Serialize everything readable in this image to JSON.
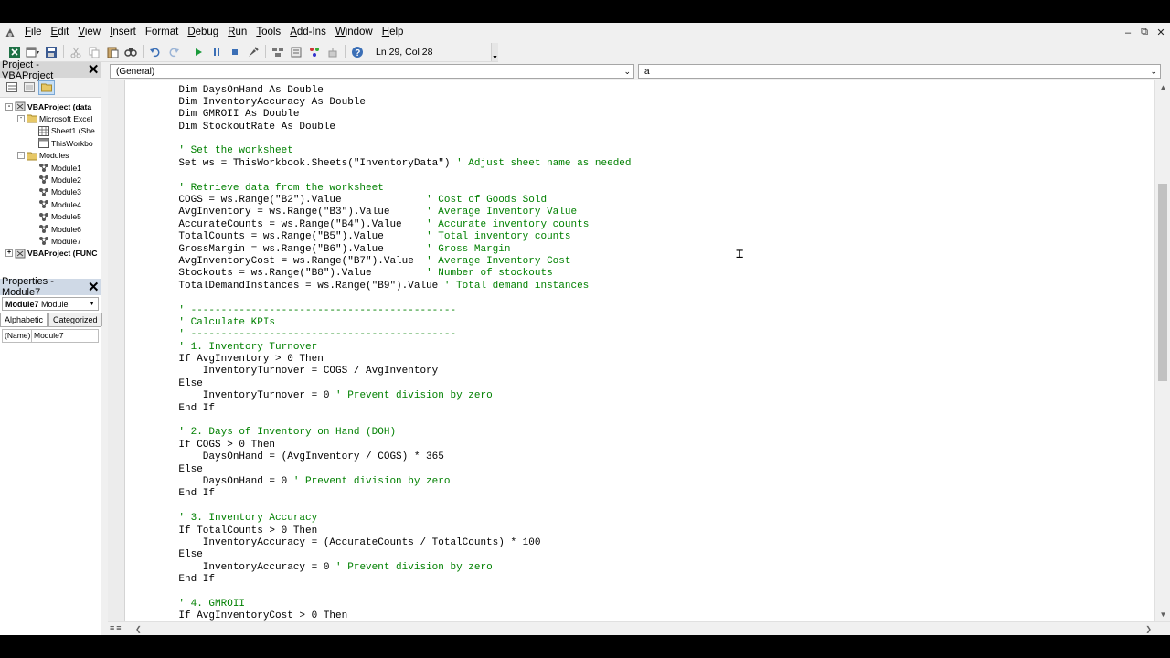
{
  "menubar": {
    "items": [
      {
        "label": "File",
        "ul": "F",
        "rest": "ile"
      },
      {
        "label": "Edit",
        "ul": "E",
        "rest": "dit"
      },
      {
        "label": "View",
        "ul": "V",
        "rest": "iew"
      },
      {
        "label": "Insert",
        "ul": "I",
        "rest": "nsert"
      },
      {
        "label": "Format",
        "ul": "",
        "rest": "Format"
      },
      {
        "label": "Debug",
        "ul": "D",
        "rest": "ebug"
      },
      {
        "label": "Run",
        "ul": "R",
        "rest": "un"
      },
      {
        "label": "Tools",
        "ul": "T",
        "rest": "ools"
      },
      {
        "label": "Add-Ins",
        "ul": "A",
        "rest": "dd-Ins"
      },
      {
        "label": "Window",
        "ul": "W",
        "rest": "indow"
      },
      {
        "label": "Help",
        "ul": "H",
        "rest": "elp"
      }
    ]
  },
  "toolbar": {
    "position_text": "Ln 29, Col 28"
  },
  "project": {
    "title": "Project - VBAProject",
    "tree": [
      {
        "label": "VBAProject (data",
        "bold": true,
        "icon": "vba-project-icon",
        "indent": 0,
        "exp": "-"
      },
      {
        "label": "Microsoft Excel",
        "bold": false,
        "icon": "folder-icon",
        "indent": 1,
        "exp": "-"
      },
      {
        "label": "Sheet1 (She",
        "bold": false,
        "icon": "sheet-icon",
        "indent": 2,
        "exp": ""
      },
      {
        "label": "ThisWorkbo",
        "bold": false,
        "icon": "workbook-icon",
        "indent": 2,
        "exp": ""
      },
      {
        "label": "Modules",
        "bold": false,
        "icon": "folder-icon",
        "indent": 1,
        "exp": "-"
      },
      {
        "label": "Module1",
        "bold": false,
        "icon": "module-icon",
        "indent": 2,
        "exp": ""
      },
      {
        "label": "Module2",
        "bold": false,
        "icon": "module-icon",
        "indent": 2,
        "exp": ""
      },
      {
        "label": "Module3",
        "bold": false,
        "icon": "module-icon",
        "indent": 2,
        "exp": ""
      },
      {
        "label": "Module4",
        "bold": false,
        "icon": "module-icon",
        "indent": 2,
        "exp": ""
      },
      {
        "label": "Module5",
        "bold": false,
        "icon": "module-icon",
        "indent": 2,
        "exp": ""
      },
      {
        "label": "Module6",
        "bold": false,
        "icon": "module-icon",
        "indent": 2,
        "exp": ""
      },
      {
        "label": "Module7",
        "bold": false,
        "icon": "module-icon",
        "indent": 2,
        "exp": ""
      },
      {
        "label": "VBAProject (FUNC",
        "bold": true,
        "icon": "vba-project-icon",
        "indent": 0,
        "exp": "+"
      }
    ]
  },
  "properties": {
    "title": "Properties - Module7",
    "selected_object_name": "Module7",
    "selected_object_type": "Module",
    "tabs": [
      "Alphabetic",
      "Categorized"
    ],
    "rows": [
      {
        "name": "(Name)",
        "value": "Module7"
      }
    ]
  },
  "code_window": {
    "object_combo": "(General)",
    "procedure_combo": "a",
    "lines": [
      [
        {
          "t": "    Dim DaysOnHand As Double",
          "c": ""
        }
      ],
      [
        {
          "t": "    Dim InventoryAccuracy As Double",
          "c": ""
        }
      ],
      [
        {
          "t": "    Dim GMROII As Double",
          "c": ""
        }
      ],
      [
        {
          "t": "    Dim StockoutRate As Double",
          "c": ""
        }
      ],
      [
        {
          "t": "",
          "c": ""
        }
      ],
      [
        {
          "t": "    ' Set the worksheet",
          "c": "g"
        }
      ],
      [
        {
          "t": "    Set ws = ThisWorkbook.Sheets(\"InventoryData\") ",
          "c": ""
        },
        {
          "t": "' Adjust sheet name as needed",
          "c": "g"
        }
      ],
      [
        {
          "t": "",
          "c": ""
        }
      ],
      [
        {
          "t": "    ' Retrieve data from the worksheet",
          "c": "g"
        }
      ],
      [
        {
          "t": "    COGS = ws.Range(\"B2\").Value              ",
          "c": ""
        },
        {
          "t": "' Cost of Goods Sold",
          "c": "g"
        }
      ],
      [
        {
          "t": "    AvgInventory = ws.Range(\"B3\").Value      ",
          "c": ""
        },
        {
          "t": "' Average Inventory Value",
          "c": "g"
        }
      ],
      [
        {
          "t": "    AccurateCounts = ws.Range(\"B4\").Value    ",
          "c": ""
        },
        {
          "t": "' Accurate inventory counts",
          "c": "g"
        }
      ],
      [
        {
          "t": "    TotalCounts = ws.Range(\"B5\").Value       ",
          "c": ""
        },
        {
          "t": "' Total inventory counts",
          "c": "g"
        }
      ],
      [
        {
          "t": "    GrossMargin = ws.Range(\"B6\").Value       ",
          "c": ""
        },
        {
          "t": "' Gross Margin",
          "c": "g"
        }
      ],
      [
        {
          "t": "    AvgInventoryCost = ws.Range(\"B7\").Value  ",
          "c": ""
        },
        {
          "t": "' Average Inventory Cost",
          "c": "g"
        }
      ],
      [
        {
          "t": "    Stockouts = ws.Range(\"B8\").Value         ",
          "c": ""
        },
        {
          "t": "' Number of stockouts",
          "c": "g"
        }
      ],
      [
        {
          "t": "    TotalDemandInstances = ws.Range(\"B9\").Value ",
          "c": ""
        },
        {
          "t": "' Total demand instances",
          "c": "g"
        }
      ],
      [
        {
          "t": "",
          "c": ""
        }
      ],
      [
        {
          "t": "    ' --------------------------------------------",
          "c": "g"
        }
      ],
      [
        {
          "t": "    ' Calculate KPIs",
          "c": "g"
        }
      ],
      [
        {
          "t": "    ' --------------------------------------------",
          "c": "g"
        }
      ],
      [
        {
          "t": "    ' 1. Inventory Turnover",
          "c": "g"
        }
      ],
      [
        {
          "t": "    If AvgInventory > 0 Then",
          "c": ""
        }
      ],
      [
        {
          "t": "        InventoryTurnover = COGS / AvgInventory",
          "c": ""
        }
      ],
      [
        {
          "t": "    Else",
          "c": ""
        }
      ],
      [
        {
          "t": "        InventoryTurnover = 0 ",
          "c": ""
        },
        {
          "t": "' Prevent division by zero",
          "c": "g"
        }
      ],
      [
        {
          "t": "    End If",
          "c": ""
        }
      ],
      [
        {
          "t": "",
          "c": ""
        }
      ],
      [
        {
          "t": "    ' 2. Days of Inventory on Hand (DOH)",
          "c": "g"
        }
      ],
      [
        {
          "t": "    If COGS > 0 Then",
          "c": ""
        }
      ],
      [
        {
          "t": "        DaysOnHand = (AvgInventory / COGS) * 365",
          "c": ""
        }
      ],
      [
        {
          "t": "    Else",
          "c": ""
        }
      ],
      [
        {
          "t": "        DaysOnHand = 0 ",
          "c": ""
        },
        {
          "t": "' Prevent division by zero",
          "c": "g"
        }
      ],
      [
        {
          "t": "    End If",
          "c": ""
        }
      ],
      [
        {
          "t": "",
          "c": ""
        }
      ],
      [
        {
          "t": "    ' 3. Inventory Accuracy",
          "c": "g"
        }
      ],
      [
        {
          "t": "    If TotalCounts > 0 Then",
          "c": ""
        }
      ],
      [
        {
          "t": "        InventoryAccuracy = (AccurateCounts / TotalCounts) * 100",
          "c": ""
        }
      ],
      [
        {
          "t": "    Else",
          "c": ""
        }
      ],
      [
        {
          "t": "        InventoryAccuracy = 0 ",
          "c": ""
        },
        {
          "t": "' Prevent division by zero",
          "c": "g"
        }
      ],
      [
        {
          "t": "    End If",
          "c": ""
        }
      ],
      [
        {
          "t": "",
          "c": ""
        }
      ],
      [
        {
          "t": "    ' 4. GMROII",
          "c": "g"
        }
      ],
      [
        {
          "t": "    If AvgInventoryCost > 0 Then",
          "c": ""
        }
      ]
    ]
  },
  "colors": {
    "comment": "#008000",
    "panel_title": "#d6d6d6",
    "properties_title": "#cfd9e6",
    "background": "#f0f0f0"
  }
}
